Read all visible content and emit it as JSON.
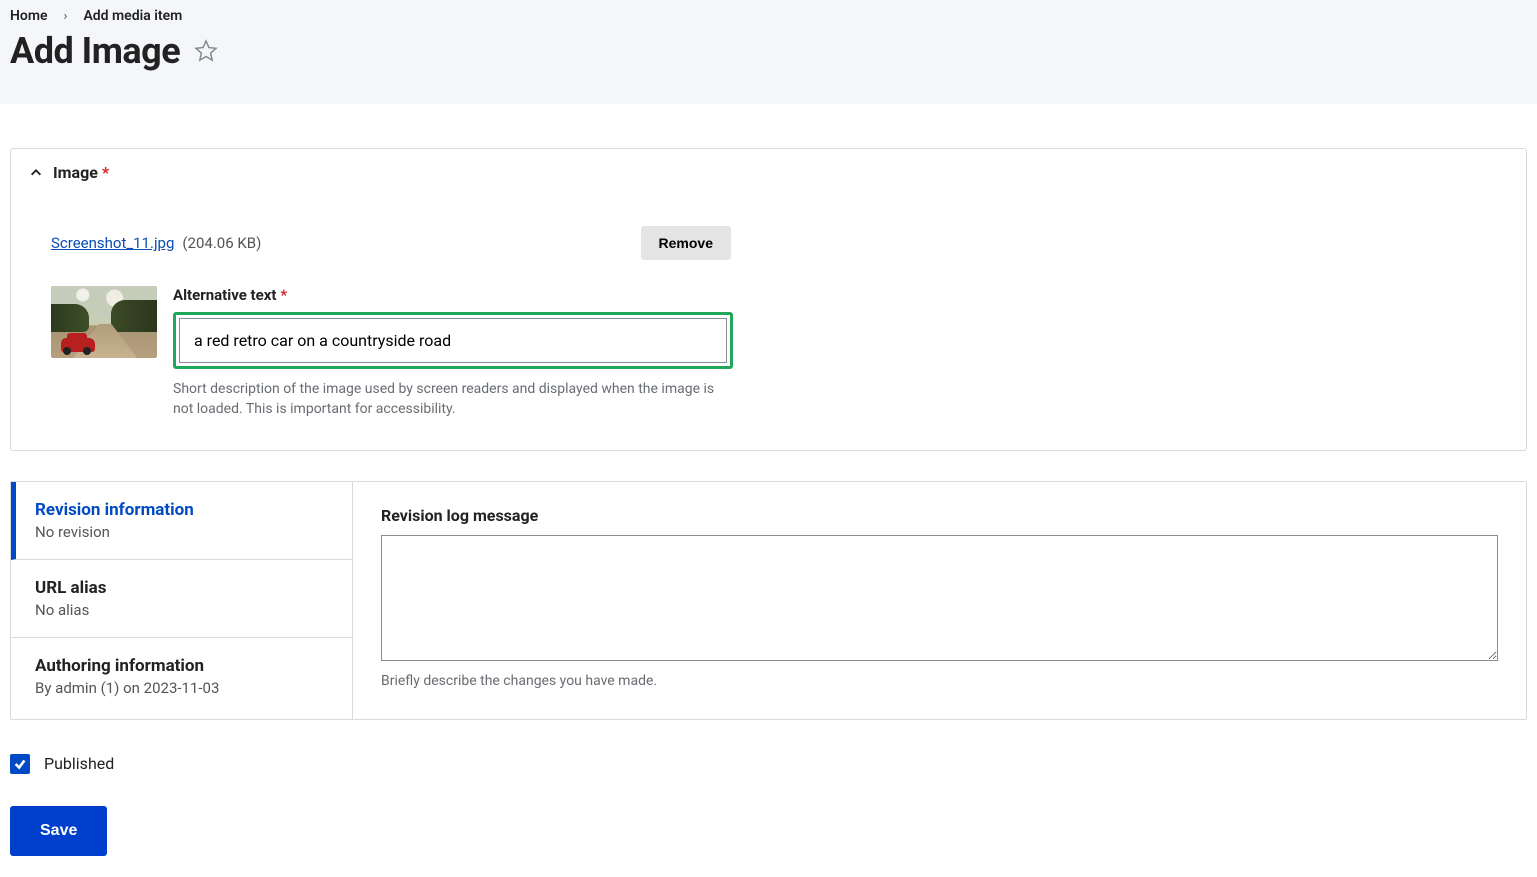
{
  "breadcrumb": {
    "home": "Home",
    "current": "Add media item"
  },
  "page_title": "Add Image",
  "panel": {
    "title": "Image",
    "file_name": "Screenshot_11.jpg",
    "file_size": "(204.06 KB)",
    "remove_label": "Remove",
    "alt_label": "Alternative text",
    "alt_value": "a red retro car on a countryside road",
    "alt_help": "Short description of the image used by screen readers and displayed when the image is not loaded. This is important for accessibility."
  },
  "vtabs": {
    "revision": {
      "title": "Revision information",
      "sub": "No revision"
    },
    "url": {
      "title": "URL alias",
      "sub": "No alias"
    },
    "author": {
      "title": "Authoring information",
      "sub": "By admin (1) on 2023-11-03"
    }
  },
  "revision_panel": {
    "label": "Revision log message",
    "value": "",
    "help": "Briefly describe the changes you have made."
  },
  "published_label": "Published",
  "save_label": "Save"
}
